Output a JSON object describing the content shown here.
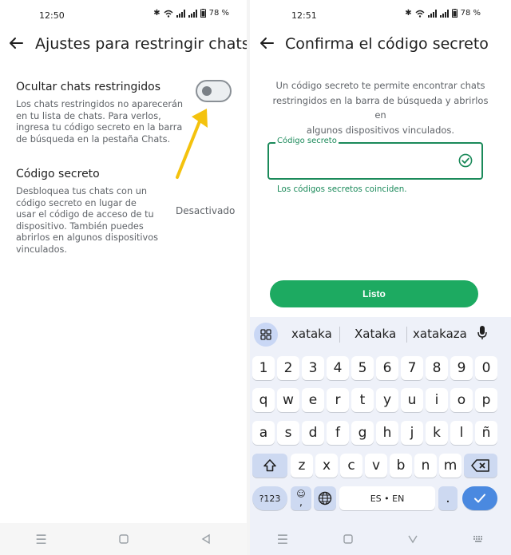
{
  "left": {
    "status": {
      "time": "12:50",
      "battery": "78 %"
    },
    "title": "Ajustes para restringir chats",
    "hide_chats": {
      "title": "Ocultar chats restringidos",
      "desc": [
        "Los chats restringidos no aparecerán",
        "en tu lista de chats. Para verlos,",
        "ingresa tu código secreto en la barra",
        "de búsqueda en la pestaña Chats."
      ]
    },
    "secret_code": {
      "title": "Código secreto",
      "desc": [
        "Desbloquea tus chats con un",
        "código secreto en lugar de",
        "usar el código de acceso de tu",
        "dispositivo. También puedes",
        "abrirlos en algunos dispositivos",
        "vinculados."
      ],
      "value": "Desactivado"
    }
  },
  "right": {
    "status": {
      "time": "12:51",
      "battery": "78 %"
    },
    "title": "Confirma el código secreto",
    "info": [
      "Un código secreto te permite encontrar chats",
      "restringidos en la barra de búsqueda y abrirlos en",
      "algunos dispositivos vinculados."
    ],
    "field_label": "Código secreto",
    "helper": "Los códigos secretos coinciden.",
    "done_button": "Listo"
  },
  "keyboard": {
    "suggestions": [
      "xataka",
      "Xataka",
      "xatakaza"
    ],
    "row_numbers": [
      "1",
      "2",
      "3",
      "4",
      "5",
      "6",
      "7",
      "8",
      "9",
      "0"
    ],
    "row_q": [
      "q",
      "w",
      "e",
      "r",
      "t",
      "y",
      "u",
      "i",
      "o",
      "p"
    ],
    "row_a": [
      "a",
      "s",
      "d",
      "f",
      "g",
      "h",
      "j",
      "k",
      "l",
      "ñ"
    ],
    "row_z": [
      "z",
      "x",
      "c",
      "v",
      "b",
      "n",
      "m"
    ],
    "symbols_key": "?123",
    "comma_key": ",",
    "emoji_key": "☺",
    "space_label": "ES • EN",
    "period_key": "."
  },
  "colors": {
    "accent": "#1daa61",
    "accent_dark": "#1b8a5a",
    "arrow": "#f4c20d",
    "enter_key": "#4a89e0"
  }
}
